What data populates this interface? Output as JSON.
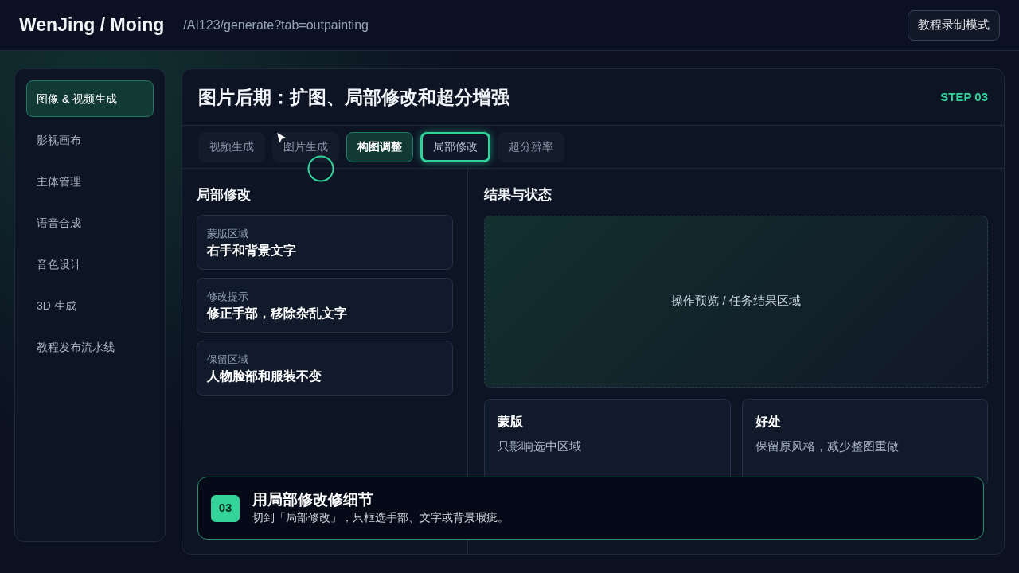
{
  "header": {
    "brand": "WenJing / Moing",
    "path": "/AI123/generate?tab=outpainting",
    "button": "教程录制模式"
  },
  "sidebar": {
    "items": [
      {
        "label": "图像 & 视频生成",
        "selected": true
      },
      {
        "label": "影视画布",
        "selected": false
      },
      {
        "label": "主体管理",
        "selected": false
      },
      {
        "label": "语音合成",
        "selected": false
      },
      {
        "label": "音色设计",
        "selected": false
      },
      {
        "label": "3D 生成",
        "selected": false
      },
      {
        "label": "教程发布流水线",
        "selected": false
      }
    ]
  },
  "panel": {
    "title": "图片后期：扩图、局部修改和超分增强",
    "step": "STEP 03"
  },
  "tabs": [
    {
      "label": "视频生成",
      "selected": false,
      "highlighted": false
    },
    {
      "label": "图片生成",
      "selected": false,
      "highlighted": false
    },
    {
      "label": "构图调整",
      "selected": true,
      "highlighted": false
    },
    {
      "label": "局部修改",
      "selected": false,
      "highlighted": true
    },
    {
      "label": "超分辨率",
      "selected": false,
      "highlighted": false
    }
  ],
  "form": {
    "title": "局部修改",
    "fields": [
      {
        "label": "蒙版区域",
        "value": "右手和背景文字"
      },
      {
        "label": "修改提示",
        "value": "修正手部，移除杂乱文字"
      },
      {
        "label": "保留区域",
        "value": "人物脸部和服装不变"
      }
    ]
  },
  "result": {
    "title": "结果与状态",
    "preview": "操作预览 / 任务结果区域",
    "cards": [
      {
        "title": "蒙版",
        "text": "只影响选中区域"
      },
      {
        "title": "好处",
        "text": "保留原风格，减少整图重做"
      }
    ]
  },
  "toast": {
    "badge": "03",
    "title": "用局部修改修细节",
    "text": "切到「局部修改」，只框选手部、文字或背景瑕疵。"
  }
}
